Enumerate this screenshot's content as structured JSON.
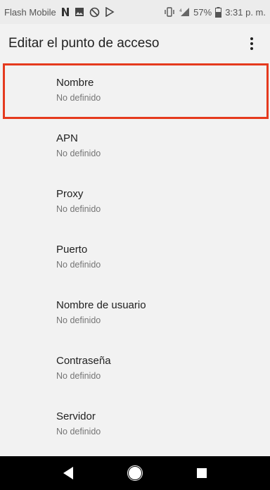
{
  "status_bar": {
    "carrier": "Flash Mobile",
    "battery_percent": "57%",
    "time": "3:31 p. m.",
    "icons": [
      "n-notification-icon",
      "image-notification-icon",
      "cast-off-icon",
      "play-store-icon",
      "vibrate-icon",
      "signal-icon",
      "battery-icon"
    ]
  },
  "app_bar": {
    "title": "Editar el punto de acceso",
    "overflow_icon": "more-vert-icon"
  },
  "items": [
    {
      "title": "Nombre",
      "summary": "No definido"
    },
    {
      "title": "APN",
      "summary": "No definido"
    },
    {
      "title": "Proxy",
      "summary": "No definido"
    },
    {
      "title": "Puerto",
      "summary": "No definido"
    },
    {
      "title": "Nombre de usuario",
      "summary": "No definido"
    },
    {
      "title": "Contraseña",
      "summary": "No definido"
    },
    {
      "title": "Servidor",
      "summary": "No definido"
    }
  ],
  "highlight_color": "#e53a1e",
  "nav_bar": {
    "icons": [
      "back-icon",
      "home-icon",
      "recents-icon"
    ]
  }
}
